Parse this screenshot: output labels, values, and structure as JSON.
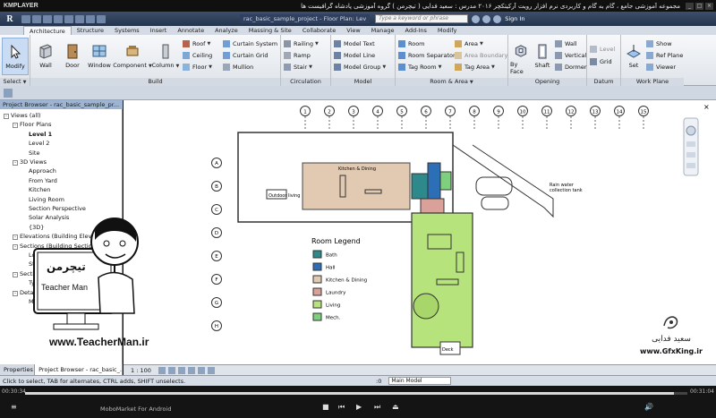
{
  "player": {
    "logo": "KMPLAYER",
    "video_title": "مجموعه آموزشی جامع ، گام به گام و کاربردی نرم افزار رویت آرکیتکچر ۲۰۱۶   مدرس : سعید فدایی ( تیچرمن ) گروه آموزشی پادشاه گرافیست ها",
    "elapsed": "00:30:34",
    "total": "00:31:04",
    "progress": 0.98,
    "ad_text": "MoboMarket For Android"
  },
  "revit": {
    "app_letter": "R",
    "doc_title": "rac_basic_sample_project - Floor Plan: Lev",
    "search_placeholder": "Type a keyword or phrase",
    "sign_in": "Sign In",
    "tabs": [
      "Architecture",
      "Structure",
      "Systems",
      "Insert",
      "Annotate",
      "Analyze",
      "Massing & Site",
      "Collaborate",
      "View",
      "Manage",
      "Add-Ins",
      "Modify"
    ],
    "active_tab": "Architecture",
    "panels": {
      "select": "Select",
      "build": "Build",
      "circulation": "Circulation",
      "model": "Model",
      "room_area": "Room & Area",
      "opening": "Opening",
      "datum": "Datum",
      "work_plane": "Work Plane"
    },
    "buttons": {
      "modify": "Modify",
      "wall": "Wall",
      "door": "Door",
      "window": "Window",
      "component": "Component",
      "column": "Column",
      "roof": "Roof",
      "ceiling": "Ceiling",
      "floor": "Floor",
      "curtain_system": "Curtain System",
      "curtain_grid": "Curtain Grid",
      "mullion": "Mullion",
      "railing": "Railing",
      "ramp": "Ramp",
      "stair": "Stair",
      "model_text": "Model Text",
      "model_line": "Model Line",
      "model_group": "Model Group",
      "room": "Room",
      "room_separator": "Room Separator",
      "tag_room": "Tag Room",
      "area": "Area",
      "area_boundary": "Area Boundary",
      "tag_area": "Tag Area",
      "by_face": "By Face",
      "shaft": "Shaft",
      "opening_wall": "Wall",
      "vertical": "Vertical",
      "dormer": "Dormer",
      "level": "Level",
      "grid": "Grid",
      "set": "Set",
      "show": "Show",
      "ref_plane": "Ref Plane",
      "viewer": "Viewer"
    }
  },
  "browser": {
    "title": "Project Browser - rac_basic_sample_pr...",
    "items": [
      {
        "label": "Views (all)",
        "indent": 0,
        "exp": "-"
      },
      {
        "label": "Floor Plans",
        "indent": 1,
        "exp": "-"
      },
      {
        "label": "Level 1",
        "indent": 2,
        "bold": true
      },
      {
        "label": "Level 2",
        "indent": 2
      },
      {
        "label": "Site",
        "indent": 2
      },
      {
        "label": "3D Views",
        "indent": 1,
        "exp": "-"
      },
      {
        "label": "Approach",
        "indent": 2
      },
      {
        "label": "From Yard",
        "indent": 2
      },
      {
        "label": "Kitchen",
        "indent": 2
      },
      {
        "label": "Living Room",
        "indent": 2
      },
      {
        "label": "Section Perspective",
        "indent": 2
      },
      {
        "label": "Solar Analysis",
        "indent": 2
      },
      {
        "label": "{3D}",
        "indent": 2
      },
      {
        "label": "Elevations (Building Elevation)",
        "indent": 1,
        "exp": "-"
      },
      {
        "label": "Sections (Building Section)",
        "indent": 1,
        "exp": "-"
      },
      {
        "label": "Longitudinal Section",
        "indent": 2
      },
      {
        "label": "Stair Section",
        "indent": 2
      },
      {
        "label": "Sections (Wall Section)",
        "indent": 1,
        "exp": "-"
      },
      {
        "label": "Typical Wall Section",
        "indent": 2
      },
      {
        "label": "Detail Views (Detail)",
        "indent": 1,
        "exp": "-"
      },
      {
        "label": "Main Stair Detail",
        "indent": 2
      }
    ],
    "tab_properties": "Properties",
    "tab_browser": "Project Browser - rac_basic_..."
  },
  "viewbar": {
    "scale": "1 : 100"
  },
  "statusbar": {
    "text": "Click to select, TAB for alternates, CTRL adds, SHIFT unselects.",
    "zero": ":0",
    "model": "Main Model"
  },
  "drawing": {
    "legend_title": "Room Legend",
    "legend": [
      {
        "label": "Bath",
        "color": "#2e8a8a"
      },
      {
        "label": "Hall",
        "color": "#2c6fb6"
      },
      {
        "label": "Kitchen & Dining",
        "color": "#e2c9b2"
      },
      {
        "label": "Laundry",
        "color": "#d9a19a"
      },
      {
        "label": "Living",
        "color": "#b6e37c"
      },
      {
        "label": "Mech.",
        "color": "#7ed07e"
      }
    ],
    "grid_top": [
      "1",
      "2",
      "3",
      "4",
      "5",
      "6",
      "7",
      "8",
      "9",
      "10",
      "11",
      "12",
      "13",
      "14",
      "15"
    ],
    "grid_left": [
      "A",
      "B",
      "C",
      "D",
      "E",
      "F",
      "G",
      "H"
    ],
    "label_outdoor": "Outdoor living",
    "label_rainwater": "Rain water\ncollection tank",
    "label_kitchen": "Kitchen & Dining",
    "label_deck": "Deck"
  },
  "watermark": {
    "name": "سعید فدایی",
    "url": "www.GfxKing.ir"
  },
  "teacher": {
    "logo_fa": "تیچرمن",
    "name": "Teacher Man",
    "url": "www.TeacherMan.ir"
  }
}
